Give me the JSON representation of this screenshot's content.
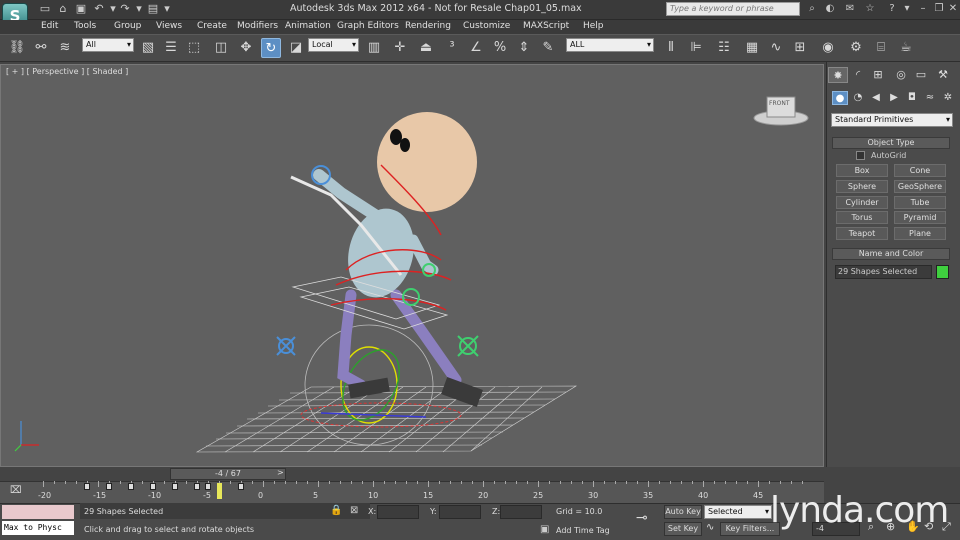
{
  "title": "Autodesk 3ds Max  2012 x64   -  Not for Resale    Chap01_05.max",
  "app_logo": "S",
  "search_placeholder": "Type a keyword or phrase",
  "menu": [
    "Edit",
    "Tools",
    "Group",
    "Views",
    "Create",
    "Modifiers",
    "Animation",
    "Graph Editors",
    "Rendering",
    "Customize",
    "MAXScript",
    "Help"
  ],
  "toolbar": {
    "selection_filter": "All",
    "ref_coord": "Local",
    "named_sets": "ALL"
  },
  "viewport": {
    "label_plus": "[ + ]",
    "label_view": "[ Perspective ]",
    "label_shading": "[ Shaded ]",
    "viewcube_label": "FRONT"
  },
  "command_panel": {
    "category": "Standard Primitives",
    "object_type_title": "Object Type",
    "autogrid_label": "AutoGrid",
    "buttons": [
      "Box",
      "Cone",
      "Sphere",
      "GeoSphere",
      "Cylinder",
      "Tube",
      "Torus",
      "Pyramid",
      "Teapot",
      "Plane"
    ],
    "name_color_title": "Name and Color",
    "name_value": "29 Shapes Selected",
    "color": "#3fcf3f"
  },
  "timeline": {
    "slider_label": "-4 / 67",
    "prev": "<",
    "next": ">",
    "ticks": [
      "-20",
      "-15",
      "-10",
      "-5",
      "0",
      "5",
      "10",
      "15",
      "20",
      "25",
      "30",
      "35",
      "40",
      "45"
    ]
  },
  "status": {
    "script_listener": "Max to Physc",
    "selected": "29 Shapes Selected",
    "prompt": "Click and drag to select and rotate objects",
    "x_label": "X:",
    "y_label": "Y:",
    "z_label": "Z:",
    "grid": "Grid = 10.0",
    "add_time_tag": "Add Time Tag",
    "auto_key": "Auto Key",
    "key_mode": "Selected",
    "set_key": "Set Key",
    "key_filters": "Key Filters...",
    "frame": "-4"
  },
  "watermark": "lynda.com"
}
